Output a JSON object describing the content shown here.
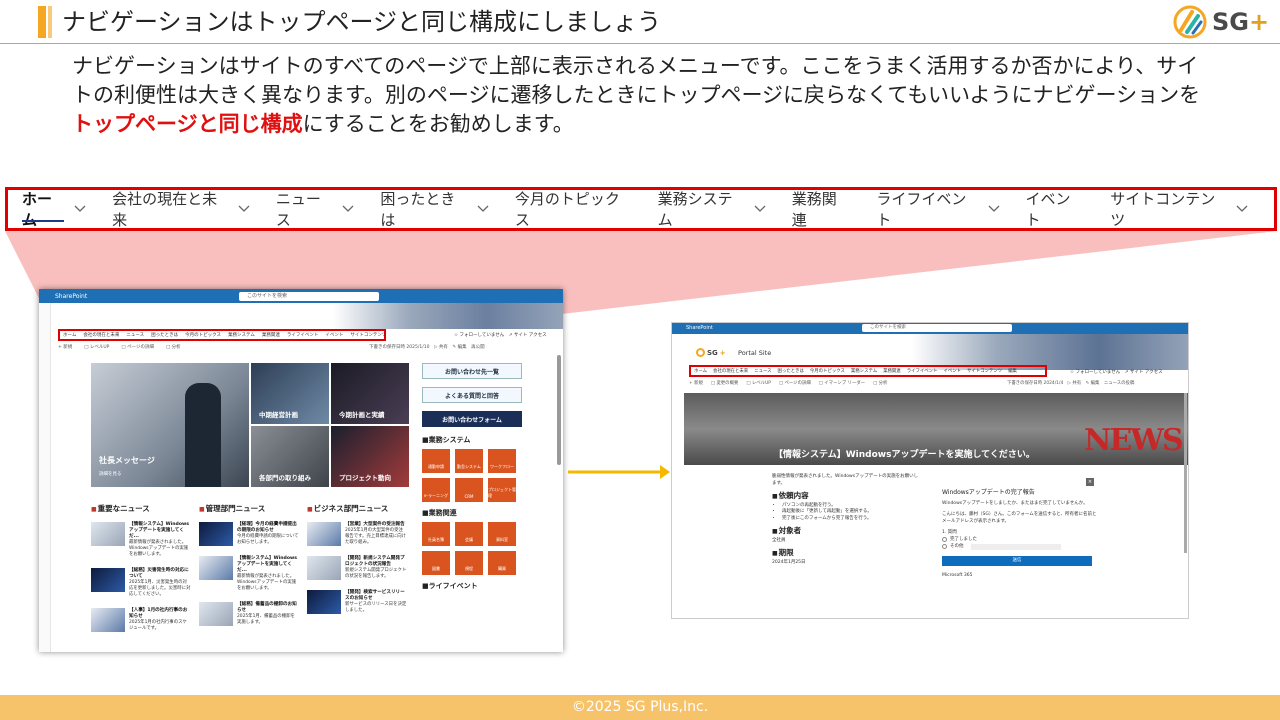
{
  "slide": {
    "title": "ナビゲーションはトップページと同じ構成にしましょう",
    "logo_text": "SG",
    "logo_plus": "+",
    "lead_part1": "ナビゲーションはサイトのすべてのページで上部に表示されるメニューです。ここをうまく活用するか否かにより、サイトの利便性は大きく異なります。別のページに遷移したときにトップページに戻らなくてもいいようにナビゲーションを",
    "lead_emphasis": "トップページと同じ構成",
    "lead_part2": "にすることをお勧めします。",
    "footer": "©2025 SG Plus,Inc."
  },
  "navigation": {
    "items": [
      {
        "label": "ホーム",
        "chevron": "v",
        "active": true
      },
      {
        "label": "会社の現在と未来",
        "chevron": "v"
      },
      {
        "label": "ニュース",
        "chevron": "v"
      },
      {
        "label": "困ったときは",
        "chevron": "v"
      },
      {
        "label": "今月のトピックス",
        "chevron": ""
      },
      {
        "label": "業務システム",
        "chevron": "v"
      },
      {
        "label": "業務関連",
        "chevron": ""
      },
      {
        "label": "ライフイベント",
        "chevron": "v"
      },
      {
        "label": "イベント",
        "chevron": ""
      },
      {
        "label": "サイトコンテンツ",
        "chevron": "v"
      }
    ]
  },
  "left_shot": {
    "app": "SharePoint",
    "search_placeholder": "このサイトを検索",
    "mini_nav": [
      "ホーム",
      "会社の現在と未来",
      "ニュース",
      "困ったときは",
      "今月のトピックス",
      "業務システム",
      "業務関連",
      "ライフイベント",
      "イベント",
      "サイトコンテンツ"
    ],
    "follow": "☆ フォローしていません　↗ サイト アクセス",
    "cmd": [
      "+ 新規",
      "□ レベルUP",
      "□ ページの詳細",
      "□ 分析"
    ],
    "published": "下書きの保存日時 2025/1/10　▷ 共有　✎ 編集　再公開",
    "tiles": {
      "ceo": "社長メッセージ",
      "ceo_sub": "詳細を見る",
      "plan": "中期経営計画",
      "results": "今期計画と実績",
      "division": "各部門の取り組み",
      "project": "プロジェクト動向"
    },
    "side_buttons": [
      "お問い合わせ先一覧",
      "よくある質問と回答",
      "お問い合わせフォーム"
    ],
    "side_h1": "業務システム",
    "sys_cells": [
      "通勤申請",
      "勤怠システム",
      "ワークフロー",
      "e-ラーニング",
      "CRM",
      "プロジェクト管理"
    ],
    "side_h2": "業務関連",
    "biz_cells": [
      "社員名簿",
      "会議",
      "資料室",
      "図書",
      "規程",
      "購買"
    ],
    "side_h3": "ライフイベント",
    "news_sections": [
      {
        "title": "重要なニュース",
        "items": [
          {
            "head": "【情報システム】Windowsアップデートを実施してくだ...",
            "body": "最新情報が発表されました。Windowsアップデートの実施をお願いします。"
          },
          {
            "head": "【総務】災害発生時の対応について",
            "body": "2025年1月、災害発生時の対応を更新しました。災害時に対応してください。"
          },
          {
            "head": "【人事】1月の社内行事のお知らせ",
            "body": "2025年1月の社内行事のスケジュールです。"
          }
        ]
      },
      {
        "title": "管理部門ニュース",
        "items": [
          {
            "head": "【経理】今月の経費申請提出の期限のお知らせ",
            "body": "今月の経費申請の期限についてお知らせします。"
          },
          {
            "head": "【情報システム】Windowsアップデートを実施してくだ...",
            "body": "最新情報が発表されました。Windowsアップデートの実施をお願いします。"
          },
          {
            "head": "【総務】備蓄品の棚卸のお知らせ",
            "body": "2025年1月、備蓄品の棚卸を実施します。"
          }
        ]
      },
      {
        "title": "ビジネス部門ニュース",
        "items": [
          {
            "head": "【営業】大型案件の受注報告",
            "body": "2025年1月の大型案件の受注報告です。売上目標達成に向けた取り組み。"
          },
          {
            "head": "【開発】新規システム開発プロジェクトの状況報告",
            "body": "新規システム開発プロジェクトの状況を報告します。"
          },
          {
            "head": "【開発】検索サービスリリースのお知らせ",
            "body": "新サービスのリリース日を決定しました。"
          }
        ]
      }
    ]
  },
  "right_shot": {
    "app": "SharePoint",
    "search_placeholder": "このサイトを検索",
    "portal": "Portal Site",
    "mini_nav": [
      "ホーム",
      "会社の現在と未来",
      "ニュース",
      "困ったときは",
      "今月のトピックス",
      "業務システム",
      "業務関連",
      "ライフイベント",
      "イベント",
      "サイトコンテンツ",
      "編集"
    ],
    "follow": "☆ フォローしていません　↗ サイト アクセス",
    "cmd": [
      "+ 新規",
      "□ 変更の概要",
      "□ レベルUP",
      "□ ページの詳細",
      "□ イマーシブ リーダー",
      "□ 分析"
    ],
    "cmd_right": "下書きの保存日時 2024/1/4　▷ 共有　✎ 編集　ニュースの投稿",
    "news_word": "NEWS",
    "news_title": "【情報システム】Windowsアップデートを実施してください。",
    "intro": "脆弱性情報が発表されました。Windowsアップデートの実施をお願いします。",
    "sec1": "依頼内容",
    "sec1_items": [
      "パソコンの再起動を行う。",
      "再起動後に「更新して再起動」を選択する。",
      "完了後にこのフォームから完了報告を行う。"
    ],
    "sec2": "対象者",
    "sec2_val": "全社員",
    "sec3": "期限",
    "sec3_val": "2024年1月25日",
    "form_title": "Windowsアップデートの完了報告",
    "form_sub": "Windowsアップデートをしましたか、またはまだ完了していませんか。",
    "form_note": "こんにちは、藤村（SG）さん。このフォームを送信すると、所有者に名前とメールアドレスが表示されます。",
    "form_q": "1. 質問",
    "form_opt1": "完了しました",
    "form_opt2": "その他",
    "form_submit": "送信",
    "ms": "Microsoft 365"
  }
}
